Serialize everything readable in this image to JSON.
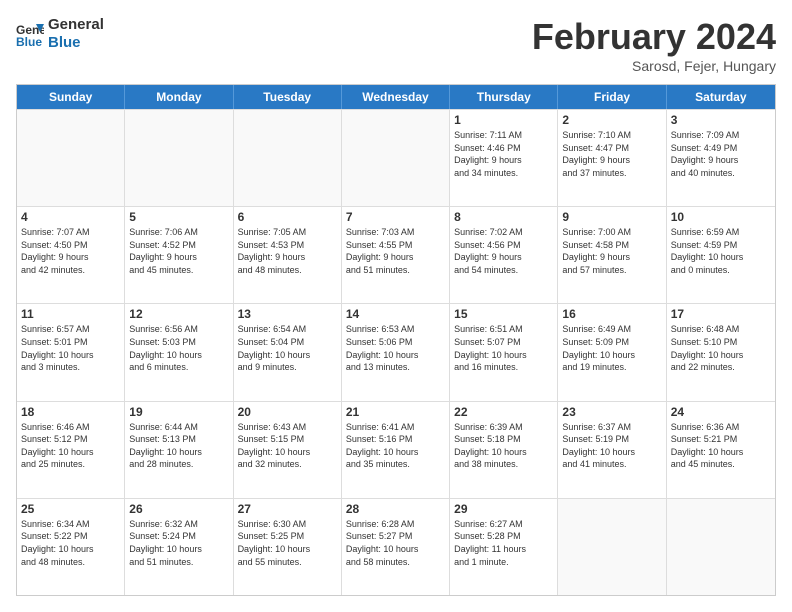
{
  "header": {
    "logo_line1": "General",
    "logo_line2": "Blue",
    "month": "February 2024",
    "location": "Sarosd, Fejer, Hungary"
  },
  "weekdays": [
    "Sunday",
    "Monday",
    "Tuesday",
    "Wednesday",
    "Thursday",
    "Friday",
    "Saturday"
  ],
  "rows": [
    [
      {
        "day": "",
        "info": ""
      },
      {
        "day": "",
        "info": ""
      },
      {
        "day": "",
        "info": ""
      },
      {
        "day": "",
        "info": ""
      },
      {
        "day": "1",
        "info": "Sunrise: 7:11 AM\nSunset: 4:46 PM\nDaylight: 9 hours\nand 34 minutes."
      },
      {
        "day": "2",
        "info": "Sunrise: 7:10 AM\nSunset: 4:47 PM\nDaylight: 9 hours\nand 37 minutes."
      },
      {
        "day": "3",
        "info": "Sunrise: 7:09 AM\nSunset: 4:49 PM\nDaylight: 9 hours\nand 40 minutes."
      }
    ],
    [
      {
        "day": "4",
        "info": "Sunrise: 7:07 AM\nSunset: 4:50 PM\nDaylight: 9 hours\nand 42 minutes."
      },
      {
        "day": "5",
        "info": "Sunrise: 7:06 AM\nSunset: 4:52 PM\nDaylight: 9 hours\nand 45 minutes."
      },
      {
        "day": "6",
        "info": "Sunrise: 7:05 AM\nSunset: 4:53 PM\nDaylight: 9 hours\nand 48 minutes."
      },
      {
        "day": "7",
        "info": "Sunrise: 7:03 AM\nSunset: 4:55 PM\nDaylight: 9 hours\nand 51 minutes."
      },
      {
        "day": "8",
        "info": "Sunrise: 7:02 AM\nSunset: 4:56 PM\nDaylight: 9 hours\nand 54 minutes."
      },
      {
        "day": "9",
        "info": "Sunrise: 7:00 AM\nSunset: 4:58 PM\nDaylight: 9 hours\nand 57 minutes."
      },
      {
        "day": "10",
        "info": "Sunrise: 6:59 AM\nSunset: 4:59 PM\nDaylight: 10 hours\nand 0 minutes."
      }
    ],
    [
      {
        "day": "11",
        "info": "Sunrise: 6:57 AM\nSunset: 5:01 PM\nDaylight: 10 hours\nand 3 minutes."
      },
      {
        "day": "12",
        "info": "Sunrise: 6:56 AM\nSunset: 5:03 PM\nDaylight: 10 hours\nand 6 minutes."
      },
      {
        "day": "13",
        "info": "Sunrise: 6:54 AM\nSunset: 5:04 PM\nDaylight: 10 hours\nand 9 minutes."
      },
      {
        "day": "14",
        "info": "Sunrise: 6:53 AM\nSunset: 5:06 PM\nDaylight: 10 hours\nand 13 minutes."
      },
      {
        "day": "15",
        "info": "Sunrise: 6:51 AM\nSunset: 5:07 PM\nDaylight: 10 hours\nand 16 minutes."
      },
      {
        "day": "16",
        "info": "Sunrise: 6:49 AM\nSunset: 5:09 PM\nDaylight: 10 hours\nand 19 minutes."
      },
      {
        "day": "17",
        "info": "Sunrise: 6:48 AM\nSunset: 5:10 PM\nDaylight: 10 hours\nand 22 minutes."
      }
    ],
    [
      {
        "day": "18",
        "info": "Sunrise: 6:46 AM\nSunset: 5:12 PM\nDaylight: 10 hours\nand 25 minutes."
      },
      {
        "day": "19",
        "info": "Sunrise: 6:44 AM\nSunset: 5:13 PM\nDaylight: 10 hours\nand 28 minutes."
      },
      {
        "day": "20",
        "info": "Sunrise: 6:43 AM\nSunset: 5:15 PM\nDaylight: 10 hours\nand 32 minutes."
      },
      {
        "day": "21",
        "info": "Sunrise: 6:41 AM\nSunset: 5:16 PM\nDaylight: 10 hours\nand 35 minutes."
      },
      {
        "day": "22",
        "info": "Sunrise: 6:39 AM\nSunset: 5:18 PM\nDaylight: 10 hours\nand 38 minutes."
      },
      {
        "day": "23",
        "info": "Sunrise: 6:37 AM\nSunset: 5:19 PM\nDaylight: 10 hours\nand 41 minutes."
      },
      {
        "day": "24",
        "info": "Sunrise: 6:36 AM\nSunset: 5:21 PM\nDaylight: 10 hours\nand 45 minutes."
      }
    ],
    [
      {
        "day": "25",
        "info": "Sunrise: 6:34 AM\nSunset: 5:22 PM\nDaylight: 10 hours\nand 48 minutes."
      },
      {
        "day": "26",
        "info": "Sunrise: 6:32 AM\nSunset: 5:24 PM\nDaylight: 10 hours\nand 51 minutes."
      },
      {
        "day": "27",
        "info": "Sunrise: 6:30 AM\nSunset: 5:25 PM\nDaylight: 10 hours\nand 55 minutes."
      },
      {
        "day": "28",
        "info": "Sunrise: 6:28 AM\nSunset: 5:27 PM\nDaylight: 10 hours\nand 58 minutes."
      },
      {
        "day": "29",
        "info": "Sunrise: 6:27 AM\nSunset: 5:28 PM\nDaylight: 11 hours\nand 1 minute."
      },
      {
        "day": "",
        "info": ""
      },
      {
        "day": "",
        "info": ""
      }
    ]
  ]
}
